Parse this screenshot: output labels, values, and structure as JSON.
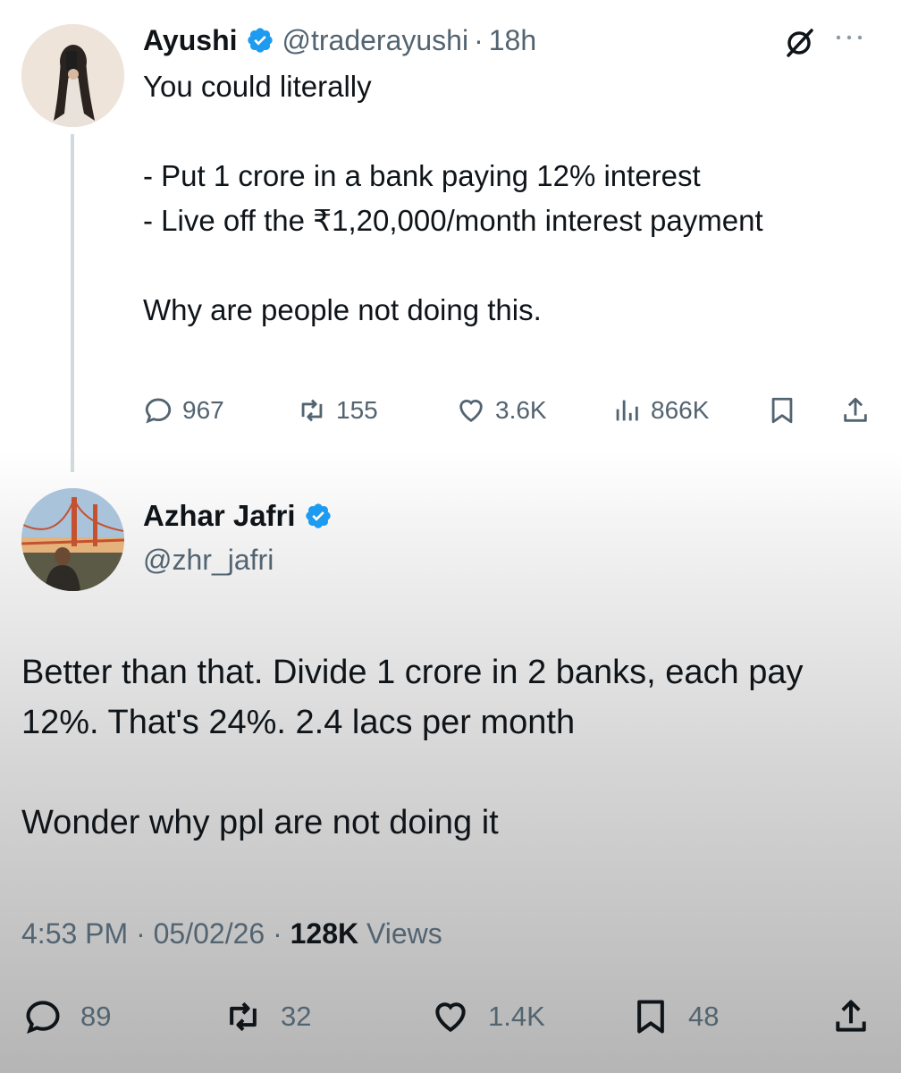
{
  "tweet1": {
    "author_name": "Ayushi",
    "handle": "@traderayushi",
    "separator": "·",
    "time": "18h",
    "text": "You could literally\n\n- Put 1 crore  in a bank paying 12% interest\n- Live off the ₹1,20,000/month interest payment\n\nWhy are people not doing this.",
    "replies": "967",
    "reposts": "155",
    "likes": "3.6K",
    "views": "866K",
    "icons": [
      "grok-icon",
      "more-icon",
      "reply-icon",
      "repost-icon",
      "like-icon",
      "views-icon",
      "bookmark-icon",
      "share-icon"
    ]
  },
  "tweet2": {
    "author_name": "Azhar Jafri",
    "handle": "@zhr_jafri",
    "text": "Better than that. Divide 1 crore in 2 banks, each pay 12%. That's 24%. 2.4 lacs per month\n\nWonder why ppl are not doing it",
    "time": "4:53 PM",
    "date": "05/02/26",
    "separator": "·",
    "views_count": "128K",
    "views_label": "Views",
    "replies": "89",
    "reposts": "32",
    "likes": "1.4K",
    "bookmarks": "48"
  },
  "colors": {
    "text_primary": "#0f1419",
    "text_secondary": "#536471",
    "verified_blue": "#1d9bf0",
    "thread_line": "#cfd9de"
  }
}
